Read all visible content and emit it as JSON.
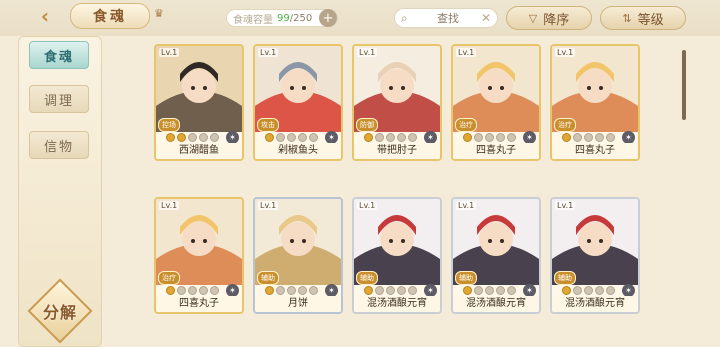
{
  "header": {
    "title": "食魂",
    "capacity_label": "食魂容量",
    "capacity_current": "99",
    "capacity_max": "/250",
    "search_label": "查找",
    "sort_label": "降序",
    "level_label": "等级"
  },
  "sidebar": {
    "tabs": [
      {
        "label": "食魂",
        "active": true
      },
      {
        "label": "调理",
        "active": false
      },
      {
        "label": "信物",
        "active": false
      }
    ],
    "decompose_label": "分解"
  },
  "cards": [
    {
      "name": "西湖醋鱼",
      "level": "Lv.1",
      "role": "控场",
      "stars": 2,
      "element": "✶",
      "palette": [
        "#e9d6b0",
        "#5b4a3b",
        "#2f2a26"
      ]
    },
    {
      "name": "剁椒鱼头",
      "level": "Lv.1",
      "role": "攻击",
      "stars": 1,
      "element": "✶",
      "palette": [
        "#efe3d3",
        "#d93c2e",
        "#8b96a6"
      ]
    },
    {
      "name": "带把肘子",
      "level": "Lv.1",
      "role": "防御",
      "stars": 1,
      "element": "✶",
      "palette": [
        "#f5ede0",
        "#b7322c",
        "#e9d1b8"
      ]
    },
    {
      "name": "四喜丸子",
      "level": "Lv.1",
      "role": "治疗",
      "stars": 1,
      "element": "✶",
      "palette": [
        "#f3e6cf",
        "#d97c43",
        "#f2c56a"
      ]
    },
    {
      "name": "四喜丸子",
      "level": "Lv.1",
      "role": "治疗",
      "stars": 1,
      "element": "✶",
      "palette": [
        "#f3e6cf",
        "#d97c43",
        "#f2c56a"
      ]
    },
    {
      "name": "四喜丸子",
      "level": "Lv.1",
      "role": "治疗",
      "stars": 1,
      "element": "✶",
      "palette": [
        "#f3e6cf",
        "#d97c43",
        "#f2c56a"
      ]
    },
    {
      "name": "月饼",
      "level": "Lv.1",
      "role": "辅助",
      "stars": 1,
      "element": "✶",
      "palette": [
        "#f2ead6",
        "#c9a25e",
        "#e9c98a"
      ]
    },
    {
      "name": "混汤酒酿元宵",
      "level": "Lv.1",
      "role": "辅助",
      "stars": 1,
      "element": "✶",
      "palette": [
        "#f3eef0",
        "#2a2230",
        "#c73a3a"
      ]
    },
    {
      "name": "混汤酒酿元宵",
      "level": "Lv.1",
      "role": "辅助",
      "stars": 1,
      "element": "✶",
      "palette": [
        "#f3eef0",
        "#2a2230",
        "#c73a3a"
      ]
    },
    {
      "name": "混汤酒酿元宵",
      "level": "Lv.1",
      "role": "辅助",
      "stars": 1,
      "element": "✶",
      "palette": [
        "#f3eef0",
        "#2a2230",
        "#c73a3a"
      ]
    }
  ]
}
